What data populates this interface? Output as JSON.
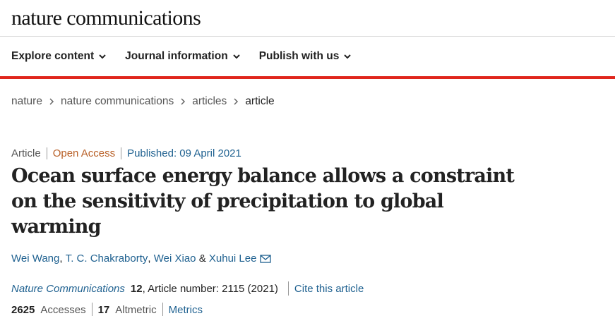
{
  "site": {
    "logo": "nature communications"
  },
  "nav": {
    "items": [
      {
        "label": "Explore content"
      },
      {
        "label": "Journal information"
      },
      {
        "label": "Publish with us"
      }
    ]
  },
  "breadcrumb": [
    "nature",
    "nature communications",
    "articles",
    "article"
  ],
  "article": {
    "type": "Article",
    "access": "Open Access",
    "published": "Published: 09 April 2021",
    "title": "Ocean surface energy balance allows a constraint on the sensitivity of precipitation to global warming",
    "authors": [
      "Wei Wang",
      "T. C. Chakraborty",
      "Wei Xiao",
      "Xuhui Lee"
    ],
    "author_sep": ", ",
    "author_and": " & ",
    "journal": "Nature Communications",
    "volume": "12",
    "article_number": ", Article number: 2115 (2021)",
    "cite_label": "Cite this article"
  },
  "metrics": {
    "accesses_count": "2625",
    "accesses_label": "Accesses",
    "altmetric_count": "17",
    "altmetric_label": "Altmetric",
    "metrics_link": "Metrics"
  },
  "colors": {
    "accent_red": "#e0261c",
    "link_blue": "#1f6190",
    "open_access": "#b85f26"
  },
  "icons": {
    "nav_chevron": "chevron-down-icon",
    "crumb_sep": "chevron-right-icon",
    "mail": "mail-icon"
  }
}
